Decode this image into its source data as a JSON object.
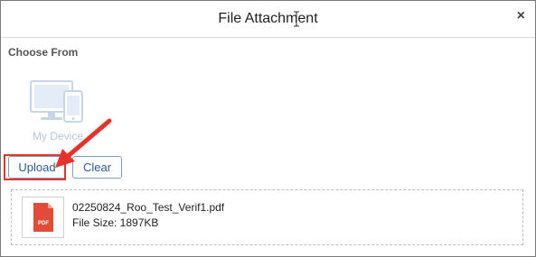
{
  "dialog": {
    "title": "File Attachment",
    "close_glyph": "×"
  },
  "source": {
    "label": "Choose From",
    "device_label": "My Device",
    "device_icon": "devices-icon"
  },
  "actions": {
    "upload_label": "Upload",
    "clear_label": "Clear"
  },
  "file": {
    "name": "02250824_Roo_Test_Verif1.pdf",
    "size_text": "File Size: 1897KB",
    "type_badge": "PDF",
    "icon": "pdf-file-icon"
  },
  "colors": {
    "accent": "#2d5b9a",
    "annotation": "#e5332a",
    "pdf_icon": "#e24b37"
  }
}
